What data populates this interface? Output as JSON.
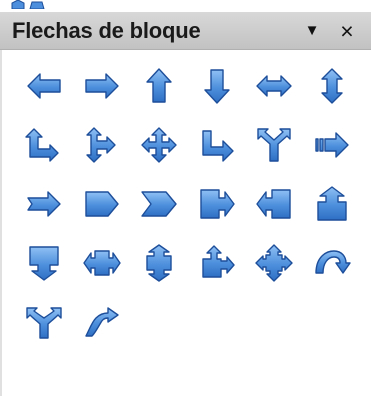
{
  "panel": {
    "title": "Flechas de bloque",
    "menu_label": "▼",
    "close_label": "×"
  },
  "colors": {
    "titlebar": "#c8c8c8",
    "arrow_fill": "#4d8fdc",
    "arrow_stroke": "#1d4e9a"
  },
  "shapes": [
    {
      "name": "left-arrow-icon"
    },
    {
      "name": "right-arrow-icon"
    },
    {
      "name": "up-arrow-icon"
    },
    {
      "name": "down-arrow-icon"
    },
    {
      "name": "left-right-arrow-icon"
    },
    {
      "name": "up-down-arrow-icon"
    },
    {
      "name": "up-right-arrow-icon"
    },
    {
      "name": "up-right-down-arrow-icon"
    },
    {
      "name": "four-way-arrow-icon"
    },
    {
      "name": "corner-right-arrow-icon"
    },
    {
      "name": "split-arrow-icon"
    },
    {
      "name": "striped-right-arrow-icon"
    },
    {
      "name": "notched-right-arrow-icon"
    },
    {
      "name": "pentagon-icon"
    },
    {
      "name": "chevron-icon"
    },
    {
      "name": "right-arrow-callout-icon"
    },
    {
      "name": "left-arrow-callout-icon"
    },
    {
      "name": "up-arrow-callout-icon"
    },
    {
      "name": "down-arrow-callout-icon"
    },
    {
      "name": "left-right-arrow-callout-icon"
    },
    {
      "name": "up-down-arrow-callout-icon"
    },
    {
      "name": "up-right-arrow-callout-icon"
    },
    {
      "name": "four-way-arrow-callout-icon"
    },
    {
      "name": "circular-arrow-icon"
    },
    {
      "name": "split-round-arrow-icon"
    },
    {
      "name": "s-shaped-arrow-icon"
    }
  ]
}
